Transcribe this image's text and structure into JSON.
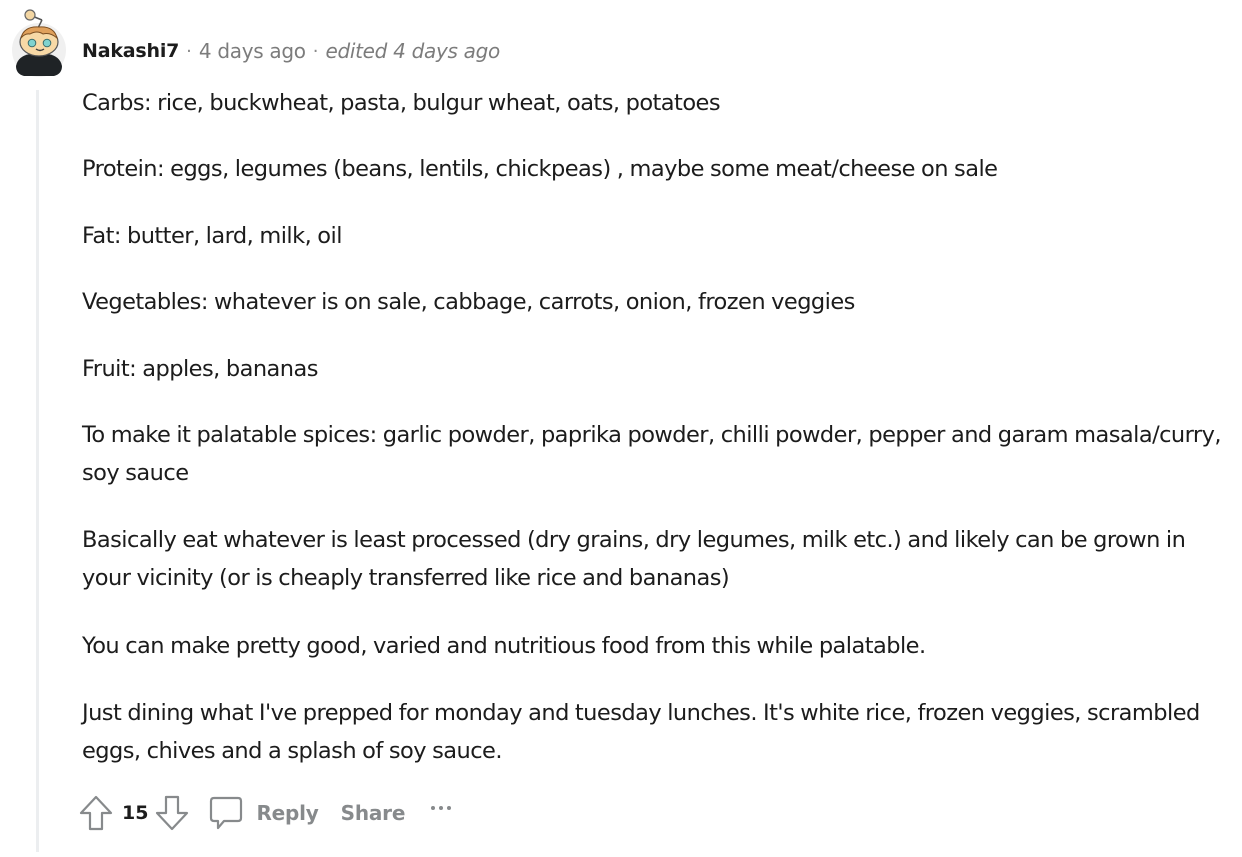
{
  "comment": {
    "author": "Nakashi7",
    "separator": "·",
    "posted": "4 days ago",
    "edited": "edited 4 days ago",
    "avatar_icon": "snoo-avatar-icon",
    "paragraphs": [
      "Carbs: rice, buckwheat, pasta, bulgur wheat, oats, potatoes",
      "Protein: eggs, legumes (beans, lentils, chickpeas) , maybe some meat/cheese on sale",
      "Fat: butter, lard, milk, oil",
      "Vegetables: whatever is on sale, cabbage, carrots, onion, frozen veggies",
      "Fruit: apples, bananas",
      "To make it palatable spices: garlic powder, paprika powder, chilli powder, pepper and garam masala/curry, soy sauce",
      "Basically eat whatever is least processed (dry grains, dry legumes, milk etc.) and likely can be grown in your vicinity (or is cheaply transferred like rice and bananas)",
      "You can make pretty good, varied and nutritious food from this while palatable.",
      "Just dining what I've prepped for monday and tuesday lunches. It's white rice, frozen veggies, scrambled eggs, chives and a splash of soy sauce."
    ]
  },
  "actions": {
    "upvote_icon": "upvote-arrow-icon",
    "score": "15",
    "downvote_icon": "downvote-arrow-icon",
    "reply_icon": "speech-bubble-icon",
    "reply_label": "Reply",
    "share_label": "Share",
    "more_icon": "ellipsis-icon"
  },
  "colors": {
    "text": "#1c1c1c",
    "meta": "#7c7c7c",
    "action": "#878a8c",
    "thread_line": "#eceef0"
  }
}
